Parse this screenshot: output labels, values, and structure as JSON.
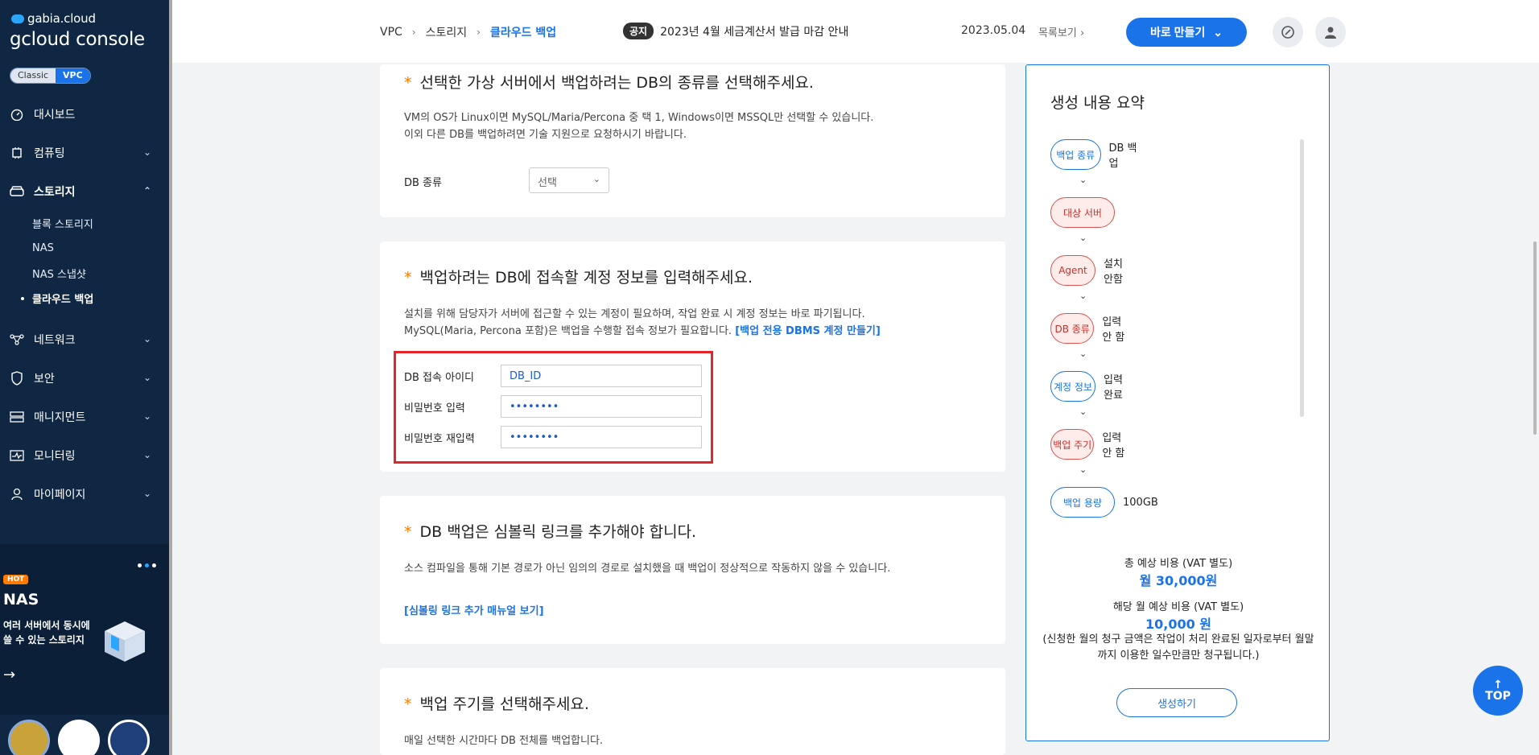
{
  "sidebar": {
    "logo_top": "gabia.cloud",
    "logo_main": "gcloud console",
    "mode_classic": "Classic",
    "mode_vpc": "VPC",
    "items": [
      {
        "label": "대시보드",
        "icon": "dashboard-icon"
      },
      {
        "label": "컴퓨팅",
        "icon": "chip-icon"
      },
      {
        "label": "스토리지",
        "icon": "storage-icon"
      },
      {
        "label": "네트워크",
        "icon": "network-icon"
      },
      {
        "label": "보안",
        "icon": "shield-icon"
      },
      {
        "label": "매니지먼트",
        "icon": "management-icon"
      },
      {
        "label": "모니터링",
        "icon": "monitor-icon"
      },
      {
        "label": "마이페이지",
        "icon": "user-icon"
      }
    ],
    "storage_sub": [
      "블록 스토리지",
      "NAS",
      "NAS 스냅샷",
      "클라우드 백업"
    ],
    "promo": {
      "hot": "HOT",
      "title": "NAS",
      "desc": "여러 서버에서 동시에 쓸 수 있는 스토리지"
    }
  },
  "topbar": {
    "breadcrumb": [
      "VPC",
      "스토리지",
      "클라우드 백업"
    ],
    "notice_tag": "공지",
    "notice_text": "2023년 4월 세금계산서 발급 마감 안내",
    "notice_date": "2023.05.04",
    "notice_list": "목록보기",
    "create_label": "바로 만들기"
  },
  "sections": {
    "db_type": {
      "title": "선택한 가상 서버에서 백업하려는 DB의 종류를 선택해주세요.",
      "desc1": "VM의 OS가 Linux이면 MySQL/Maria/Percona 중 택 1, Windows이면 MSSQL만 선택할 수 있습니다.",
      "desc2": "이외 다른 DB를 백업하려면 기술 지원으로 요청하시기 바랍니다.",
      "field_label": "DB 종류",
      "select_value": "선택"
    },
    "account": {
      "title": "백업하려는 DB에 접속할 계정 정보를 입력해주세요.",
      "desc1": "설치를 위해 담당자가 서버에 접근할 수 있는 계정이 필요하며, 작업 완료 시 계정 정보는 바로 파기됩니다.",
      "desc2": "MySQL(Maria, Percona 포함)은 백업을 수행할 접속 정보가 필요합니다.",
      "desc_link": "[백업 전용 DBMS 계정 만들기]",
      "id_label": "DB 접속 아이디",
      "id_value": "DB_ID",
      "pw_label": "비밀번호 입력",
      "pw_value": "••••••••",
      "pw2_label": "비밀번호 재입력",
      "pw2_value": "••••••••"
    },
    "symlink": {
      "title": "DB 백업은 심볼릭 링크를 추가해야 합니다.",
      "desc": "소스 컴파일을 통해 기본 경로가 아닌 임의의 경로로 설치했을 때 백업이 정상적으로 작동하지 않을 수 있습니다.",
      "link": "[심볼링 링크 추가 매뉴얼 보기]"
    },
    "cycle": {
      "title": "백업 주기를 선택해주세요.",
      "desc": "매일 선택한 시간마다 DB 전체를 백업합니다."
    }
  },
  "summary": {
    "title": "생성 내용 요약",
    "steps": [
      {
        "label": "백업 종류",
        "value": "DB 백업",
        "state": "blue"
      },
      {
        "label": "대상 서버",
        "value": "",
        "state": "red"
      },
      {
        "label": "Agent",
        "value": "설치 안함",
        "state": "red"
      },
      {
        "label": "DB 종류",
        "value": "입력 안 함",
        "state": "red"
      },
      {
        "label": "계정 정보",
        "value": "입력 완료",
        "state": "blue"
      },
      {
        "label": "백업 주기",
        "value": "입력 안 함",
        "state": "red"
      },
      {
        "label": "백업 용량",
        "value": "100GB",
        "state": "blue"
      }
    ],
    "total_label": "총 예상 비용 (VAT 별도)",
    "total_value": "월 30,000원",
    "month_label": "해당 월 예상 비용 (VAT 별도)",
    "month_value": "10,000 원",
    "note": "(신청한 월의 청구 금액은 작업이 처리 완료된 일자로부터 월말까지 이용한 일수만큼만 청구됩니다.)",
    "create_label": "생성하기"
  },
  "top_button": "TOP",
  "colors": {
    "accent": "#1a73e8",
    "sidebar": "#0f2742",
    "required": "#ff7a00",
    "highlight": "#e3262b"
  }
}
